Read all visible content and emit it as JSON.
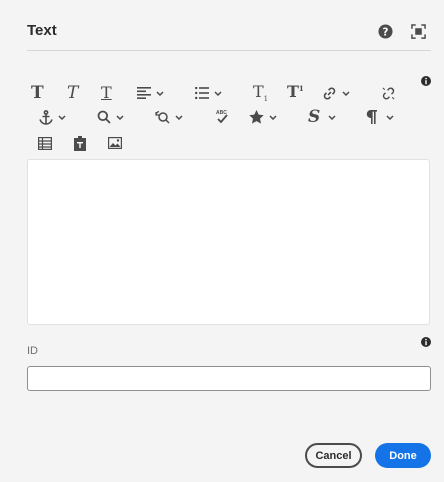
{
  "dialog": {
    "title": "Text",
    "help_icon": "help-circle-icon",
    "fullscreen_icon": "fullscreen-icon",
    "info_icon": "info-icon"
  },
  "toolbar": {
    "buttons": [
      {
        "name": "bold",
        "icon": "bold-icon",
        "glyph": "T"
      },
      {
        "name": "italic",
        "icon": "italic-icon",
        "glyph": "T"
      },
      {
        "name": "underline",
        "icon": "underline-icon",
        "glyph": "T"
      },
      {
        "name": "align",
        "icon": "align-left-icon",
        "dropdown": true
      },
      {
        "name": "list",
        "icon": "list-icon",
        "dropdown": true
      },
      {
        "name": "subscript",
        "icon": "subscript-icon",
        "glyph": "T"
      },
      {
        "name": "superscript",
        "icon": "superscript-icon",
        "glyph": "T"
      },
      {
        "name": "link",
        "icon": "link-icon",
        "dropdown": true
      },
      {
        "name": "unlink",
        "icon": "unlink-icon"
      },
      {
        "name": "anchor",
        "icon": "anchor-icon",
        "dropdown": true
      },
      {
        "name": "find",
        "icon": "search-icon",
        "dropdown": true
      },
      {
        "name": "find-replace",
        "icon": "find-replace-icon",
        "dropdown": true
      },
      {
        "name": "spellcheck",
        "icon": "spellcheck-icon",
        "glyph_label": "ABC"
      },
      {
        "name": "special-characters",
        "icon": "star-icon",
        "dropdown": true
      },
      {
        "name": "styles",
        "icon": "style-s-icon",
        "glyph": "S",
        "dropdown": true
      },
      {
        "name": "paragraph",
        "icon": "pilcrow-icon",
        "dropdown": true
      },
      {
        "name": "table",
        "icon": "table-icon"
      },
      {
        "name": "paste-plain-text",
        "icon": "paste-icon"
      },
      {
        "name": "image",
        "icon": "image-icon"
      }
    ]
  },
  "editor": {
    "content": ""
  },
  "id_field": {
    "label": "ID",
    "value": ""
  },
  "footer": {
    "cancel_label": "Cancel",
    "done_label": "Done"
  },
  "colors": {
    "accent": "#1473e6",
    "icon": "#4b4b4b",
    "background": "#f4f4f4"
  }
}
